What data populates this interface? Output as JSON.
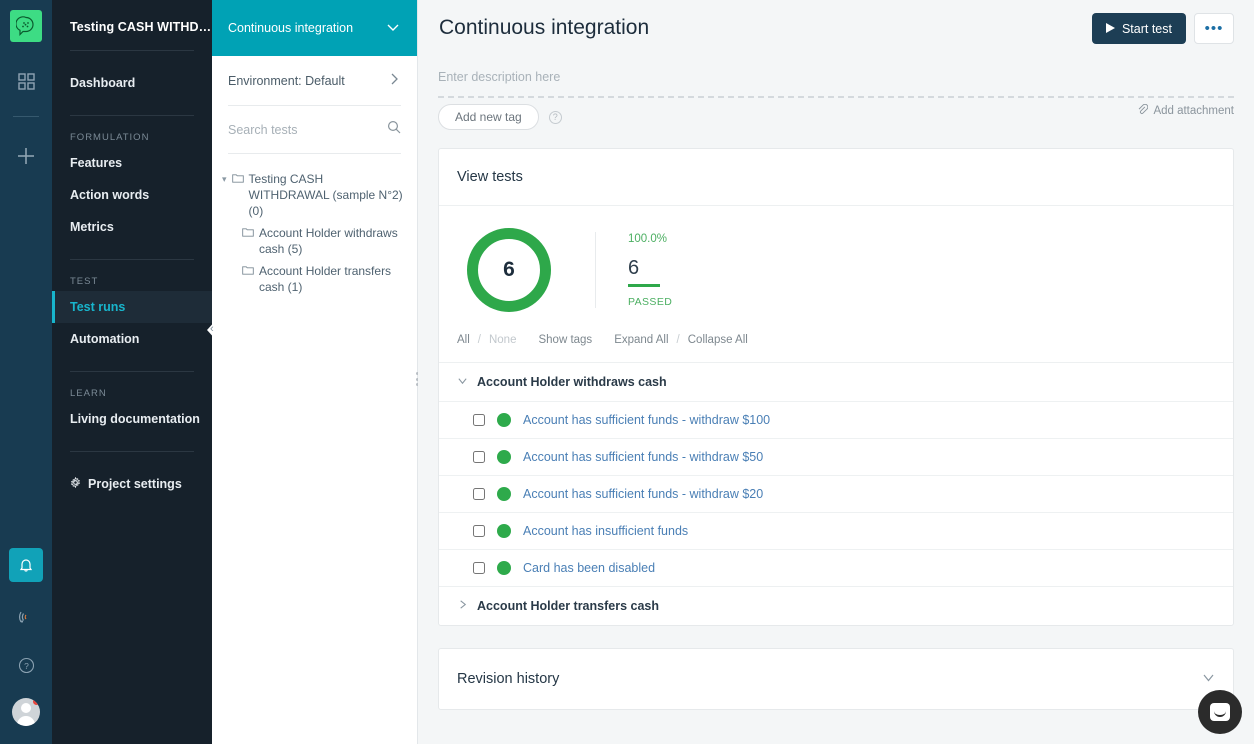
{
  "rail": {
    "logo_icon": "cucumber-logo-icon",
    "apps_icon": "grid-apps-icon",
    "add_icon": "plus-icon",
    "bell_icon": "notification-bell-icon",
    "feed_icon": "rss-feed-icon",
    "help_icon": "help-circle-icon",
    "avatar_icon": "user-avatar-icon",
    "accent_teal": "#11a2b8",
    "logo_green": "#3ddc84"
  },
  "nav": {
    "project_title": "Testing CASH WITHD…",
    "dashboard_label": "Dashboard",
    "groups": [
      {
        "title": "FORMULATION",
        "items": [
          {
            "label": "Features",
            "active": false
          },
          {
            "label": "Action words",
            "active": false
          },
          {
            "label": "Metrics",
            "active": false
          }
        ]
      },
      {
        "title": "TEST",
        "items": [
          {
            "label": "Test runs",
            "active": true
          },
          {
            "label": "Automation",
            "active": false
          }
        ]
      },
      {
        "title": "LEARN",
        "items": [
          {
            "label": "Living documentation",
            "active": false
          }
        ]
      }
    ],
    "settings_label": "Project settings",
    "settings_icon": "gear-icon",
    "collapse_icon": "chevron-left-icon",
    "active_color": "#18b5cc"
  },
  "panel": {
    "header_title": "Continuous integration",
    "header_chevron": "chevron-down-icon",
    "header_bg": "#00a2b5",
    "environment_label": "Environment: Default",
    "environment_chevron": "chevron-right-icon",
    "search_placeholder": "Search tests",
    "search_value": "",
    "search_icon": "search-icon",
    "tree": [
      {
        "label": "Testing CASH WITHDRAWAL (sample N°2) (0)",
        "depth": 0,
        "caret": "▾",
        "folder_icon": "folder-icon"
      },
      {
        "label": "Account Holder withdraws cash (5)",
        "depth": 1,
        "caret": "",
        "folder_icon": "folder-icon"
      },
      {
        "label": "Account Holder transfers cash (1)",
        "depth": 1,
        "caret": "",
        "folder_icon": "folder-icon"
      }
    ]
  },
  "main": {
    "page_title": "Continuous integration",
    "start_test_label": "Start test",
    "start_test_icon": "play-icon",
    "more_label": "•••",
    "description_placeholder": "Enter description here",
    "description_value": "",
    "add_tag_label": "Add new tag",
    "tag_help_icon": "help-circle-icon",
    "add_attachment_label": "Add attachment",
    "attachment_icon": "paperclip-icon",
    "view_tests": {
      "title": "View tests",
      "filters": {
        "all": "All",
        "slash1": "/",
        "none": "None",
        "show_tags": "Show tags",
        "expand_all": "Expand All",
        "slash2": "/",
        "collapse_all": "Collapse All"
      },
      "groups": [
        {
          "label": "Account Holder withdraws cash",
          "expanded": true,
          "chevron": "chevron-down-icon",
          "tests": [
            {
              "name": "Account has sufficient funds - withdraw $100",
              "status": "passed",
              "checked": false
            },
            {
              "name": "Account has sufficient funds - withdraw $50",
              "status": "passed",
              "checked": false
            },
            {
              "name": "Account has sufficient funds - withdraw $20",
              "status": "passed",
              "checked": false
            },
            {
              "name": "Account has insufficient funds",
              "status": "passed",
              "checked": false
            },
            {
              "name": "Card has been disabled",
              "status": "passed",
              "checked": false
            }
          ]
        },
        {
          "label": "Account Holder transfers cash",
          "expanded": false,
          "chevron": "chevron-right-icon",
          "tests": []
        }
      ]
    },
    "revision_history": {
      "title": "Revision history",
      "chevron": "chevron-down-icon"
    }
  },
  "chart_data": {
    "type": "pie",
    "title": "View tests",
    "center_label": "6",
    "categories": [
      "PASSED"
    ],
    "values": [
      6
    ],
    "total": 6,
    "percent_label": "100.0%",
    "count_label": "6",
    "status_label": "PASSED",
    "colors": [
      "#2ea84a"
    ],
    "legend": "right"
  },
  "chat": {
    "widget_icon": "chat-bubble-icon",
    "bg": "#2b2b2b"
  }
}
